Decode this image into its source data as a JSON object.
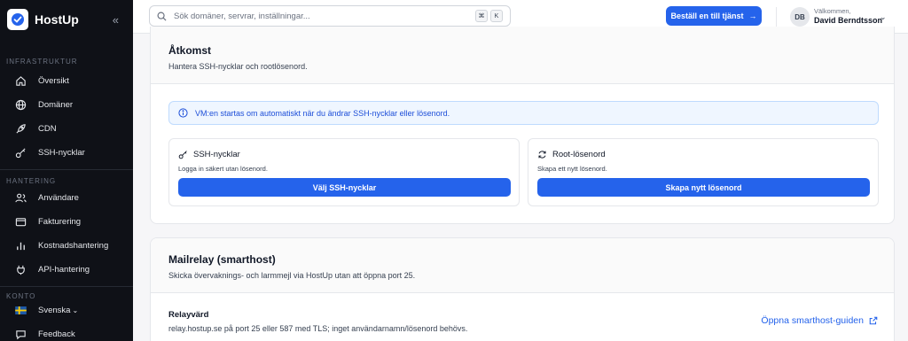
{
  "brand": {
    "name": "HostUp"
  },
  "sidebar": {
    "sections": [
      {
        "title": "Infrastruktur",
        "items": [
          {
            "label": "Översikt",
            "icon": "home-icon"
          },
          {
            "label": "Domäner",
            "icon": "globe-icon"
          },
          {
            "label": "CDN",
            "icon": "rocket-icon"
          },
          {
            "label": "SSH-nycklar",
            "icon": "key-icon"
          }
        ]
      },
      {
        "title": "Hantering",
        "items": [
          {
            "label": "Användare",
            "icon": "users-icon"
          },
          {
            "label": "Fakturering",
            "icon": "wallet-icon"
          },
          {
            "label": "Kostnadshantering",
            "icon": "chart-bars-icon"
          },
          {
            "label": "API-hantering",
            "icon": "plug-icon"
          }
        ]
      },
      {
        "title": "Konto",
        "items": [
          {
            "label": "Svenska",
            "icon": "swedish-flag-icon"
          },
          {
            "label": "Feedback",
            "icon": "feedback-icon"
          }
        ]
      }
    ]
  },
  "header": {
    "search_placeholder": "Sök domäner, servrar, inställningar...",
    "kbd_cmd": "⌘",
    "kbd_k": "K",
    "order_label": "Beställ en till tjänst",
    "avatar_initials": "DB",
    "welcome": "Välkommen,",
    "user_name": "David Berndtsson"
  },
  "access": {
    "title": "Åtkomst",
    "subtitle": "Hantera SSH-nycklar och rootlösenord.",
    "info": "VM:en startas om automatiskt när du ändrar SSH-nycklar eller lösenord.",
    "ssh": {
      "title": "SSH-nycklar",
      "desc": "Logga in säkert utan lösenord.",
      "button": "Välj SSH-nycklar"
    },
    "root": {
      "title": "Root-lösenord",
      "desc": "Skapa ett nytt lösenord.",
      "button": "Skapa nytt lösenord"
    }
  },
  "mailrelay": {
    "title": "Mailrelay (smarthost)",
    "subtitle": "Skicka övervaknings- och larmmejl via HostUp utan att öppna port 25.",
    "relay_label": "Relayvärd",
    "relay_text": "relay.hostup.se på port 25 eller 587 med TLS; inget användarnamn/lösenord behövs.",
    "guide_link": "Öppna smarthost-guiden"
  },
  "colors": {
    "accent": "#2563eb",
    "sidebar_bg": "#0f1117",
    "info_bg": "#eff6ff"
  }
}
